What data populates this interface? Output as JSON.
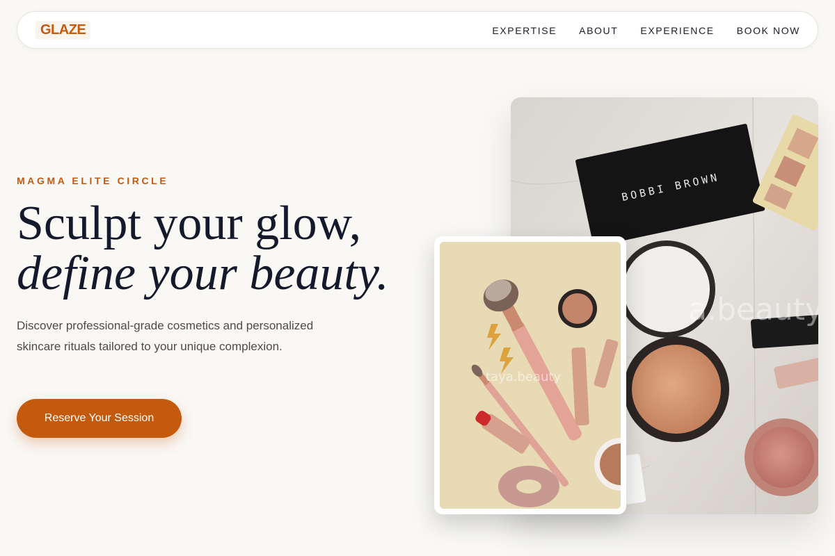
{
  "brand": {
    "logo": "GLAZE"
  },
  "nav": {
    "links": [
      "EXPERTISE",
      "ABOUT",
      "EXPERIENCE",
      "BOOK NOW"
    ]
  },
  "hero": {
    "eyebrow": "MAGMA ELITE CIRCLE",
    "headline_line1": "Sculpt your glow,",
    "headline_line2": "define your beauty.",
    "description": "Discover professional-grade cosmetics and personalized skincare rituals tailored to your unique complexion.",
    "cta_label": "Reserve Your Session"
  },
  "images": {
    "main_photo": {
      "palette_brand": "BOBBI BROWN",
      "watermark": "a.beauty"
    },
    "small_photo": {
      "watermark": "taya.beauty"
    }
  },
  "colors": {
    "accent": "#c45a0e",
    "background": "#f9f8f5",
    "headline": "#141a2c"
  }
}
